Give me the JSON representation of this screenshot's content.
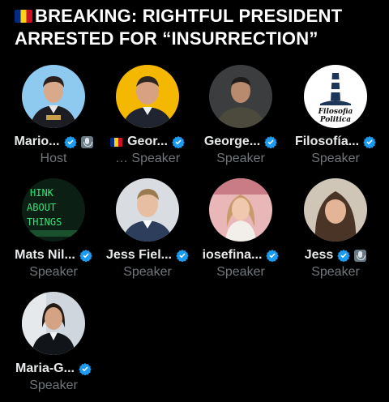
{
  "headline": "BREAKING: RIGHTFUL PRESIDENT ARRESTED FOR “INSURRECTION”",
  "colors": {
    "background": "#000000",
    "verified": "#1d9bf0",
    "muted": "#71767b"
  },
  "speakers": [
    {
      "name": "Mario...",
      "role": "Host",
      "verified": true,
      "mic": true,
      "flag": false,
      "role_prefix": ""
    },
    {
      "name": "Geor...",
      "role": "Speaker",
      "verified": true,
      "mic": false,
      "flag": true,
      "role_prefix": "… "
    },
    {
      "name": "George...",
      "role": "Speaker",
      "verified": true,
      "mic": false,
      "flag": false,
      "role_prefix": ""
    },
    {
      "name": "Filosofía...",
      "role": "Speaker",
      "verified": true,
      "mic": false,
      "flag": false,
      "role_prefix": "",
      "avatar_text": [
        "Filosofia",
        "Politica"
      ]
    },
    {
      "name": "Mats Nil...",
      "role": "Speaker",
      "verified": true,
      "mic": false,
      "flag": false,
      "role_prefix": "",
      "avatar_text": [
        "HINK",
        "ABOUT",
        "THINGS"
      ]
    },
    {
      "name": "Jess Fiel...",
      "role": "Speaker",
      "verified": true,
      "mic": false,
      "flag": false,
      "role_prefix": ""
    },
    {
      "name": "iosefina...",
      "role": "Speaker",
      "verified": true,
      "mic": false,
      "flag": false,
      "role_prefix": ""
    },
    {
      "name": "Jess",
      "role": "Speaker",
      "verified": true,
      "mic": true,
      "flag": false,
      "role_prefix": ""
    },
    {
      "name": "Maria-G...",
      "role": "Speaker",
      "verified": true,
      "mic": false,
      "flag": false,
      "role_prefix": ""
    }
  ]
}
